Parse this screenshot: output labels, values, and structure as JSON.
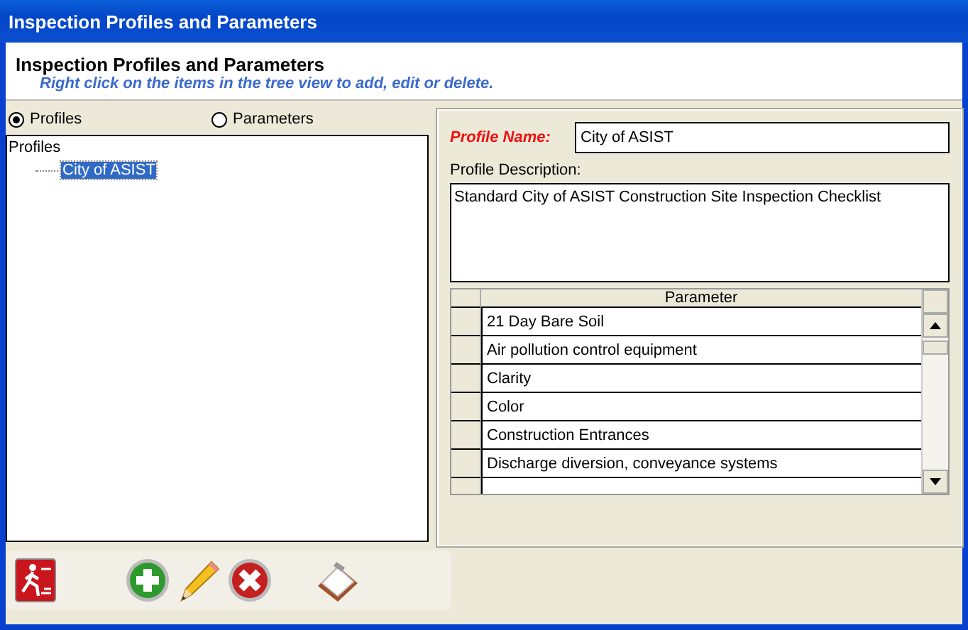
{
  "window": {
    "title": "Inspection Profiles and Parameters"
  },
  "header": {
    "title": "Inspection Profiles and Parameters",
    "hint": "Right click on the items in the tree view to add, edit or delete."
  },
  "view_options": [
    {
      "label": "Profiles",
      "selected": true
    },
    {
      "label": "Parameters",
      "selected": false
    }
  ],
  "tree": [
    {
      "label": "Profiles",
      "selected": false,
      "children": [
        {
          "label": "City of ASIST",
          "selected": true
        }
      ]
    }
  ],
  "profile": {
    "name_label": "Profile Name:",
    "name": "City of ASIST",
    "description_label": "Profile Description:",
    "description": "Standard City of ASIST Construction Site Inspection Checklist"
  },
  "table": {
    "columns": [
      "Parameter"
    ],
    "rows": [
      "21 Day Bare Soil",
      "Air pollution control equipment",
      "Clarity",
      "Color",
      "Construction Entrances",
      "Discharge diversion, conveyance systems"
    ]
  },
  "toolbar": [
    {
      "kind": "exit"
    },
    {
      "kind": "add"
    },
    {
      "kind": "edit"
    },
    {
      "kind": "delete"
    },
    {
      "kind": "report"
    }
  ]
}
